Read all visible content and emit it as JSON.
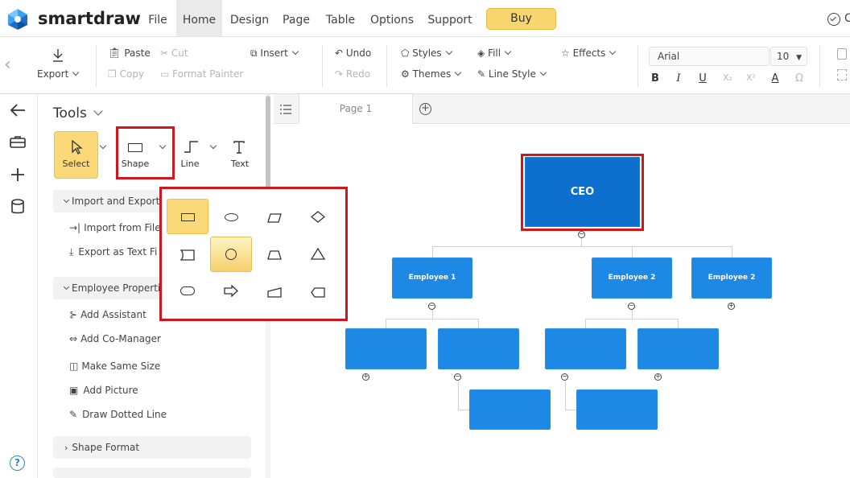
{
  "app": {
    "name": "smartdraw"
  },
  "menu": {
    "items": [
      "File",
      "Home",
      "Design",
      "Page",
      "Table",
      "Options",
      "Support"
    ],
    "buy": "Buy",
    "active": "Home"
  },
  "ribbon": {
    "export": "Export",
    "paste": "Paste",
    "cut": "Cut",
    "copy": "Copy",
    "format_painter": "Format Painter",
    "insert": "Insert",
    "undo": "Undo",
    "redo": "Redo",
    "styles": "Styles",
    "themes": "Themes",
    "fill": "Fill",
    "line_style": "Line Style",
    "effects": "Effects",
    "font": "Arial",
    "font_size": "10",
    "format_buttons": [
      "B",
      "I",
      "U",
      "X₂",
      "X²",
      "A",
      "Ω"
    ]
  },
  "page_tabs": {
    "tab": "Page 1"
  },
  "tools": {
    "title": "Tools",
    "buttons": {
      "select": "Select",
      "shape": "Shape",
      "line": "Line",
      "text": "Text"
    },
    "sections": {
      "import_export": {
        "title": "Import and Export",
        "items": [
          "Import from File",
          "Export as Text Fi"
        ]
      },
      "employee": {
        "title": "Employee Propertie",
        "items": [
          "Add Assistant",
          "Add Co-Manager",
          "Make Same Size",
          "Add Picture",
          "Draw Dotted Line"
        ]
      },
      "shape_format": {
        "title": "Shape Format"
      }
    }
  },
  "chart": {
    "ceo": "CEO",
    "employees": [
      "Employee 1",
      "Employee 2",
      "Employee 2"
    ]
  },
  "colors": {
    "accent_red": "#d0171f",
    "box_blue": "#1e88e5",
    "ceo_blue": "#0d6fce",
    "buy_yellow": "#f8d66e"
  }
}
